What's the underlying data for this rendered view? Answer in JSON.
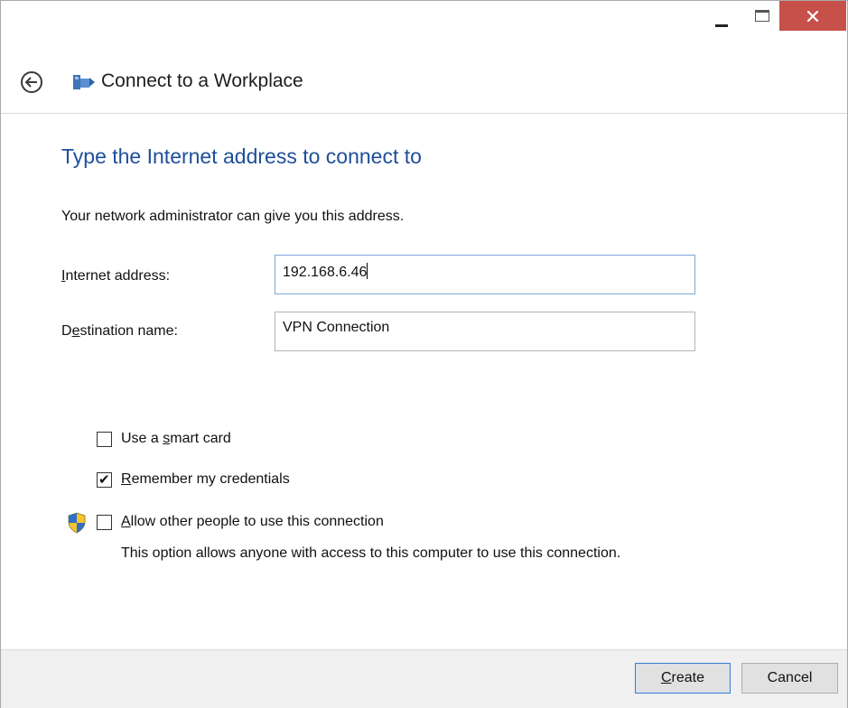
{
  "window": {
    "controls": {
      "minimize": "minimize",
      "maximize": "maximize",
      "close": "close"
    }
  },
  "header": {
    "title": "Connect to a Workplace",
    "back_icon": "back-arrow-icon",
    "app_icon": "workplace-network-icon"
  },
  "main": {
    "title": "Type the Internet address to connect to",
    "subtitle": "Your network administrator can give you this address.",
    "internet_address": {
      "label_prefix": "",
      "label_access": "I",
      "label_rest": "nternet address:",
      "value": "192.168.6.46"
    },
    "destination_name": {
      "label_prefix": "D",
      "label_access": "e",
      "label_rest": "stination name:",
      "value": "VPN Connection"
    },
    "options": {
      "smart_card": {
        "label_prefix": "Use a ",
        "label_access": "s",
        "label_rest": "mart card",
        "checked": false
      },
      "remember": {
        "label_prefix": "",
        "label_access": "R",
        "label_rest": "emember my credentials",
        "checked": true,
        "check_glyph": "✔"
      },
      "allow_others": {
        "label_prefix": "",
        "label_access": "A",
        "label_rest": "llow other people to use this connection",
        "checked": false,
        "description": "This option allows anyone with access to this computer to use this connection.",
        "icon": "uac-shield-icon"
      }
    }
  },
  "footer": {
    "create": {
      "access": "C",
      "rest": "reate"
    },
    "cancel_label": "Cancel"
  },
  "colors": {
    "title_blue": "#1e4f9a",
    "close_red": "#c7504a",
    "focus_border": "#7aa7d9"
  }
}
